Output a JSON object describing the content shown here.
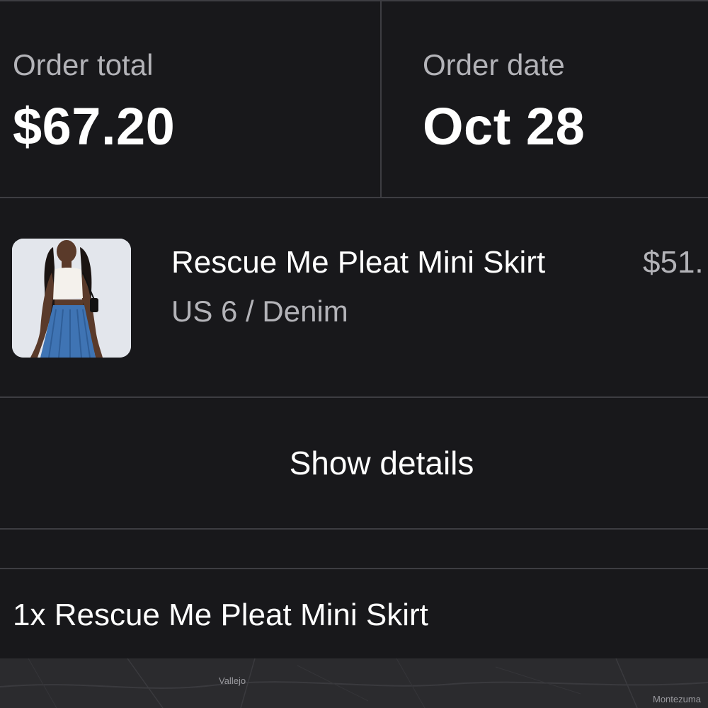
{
  "summary": {
    "total_label": "Order total",
    "total_value": "$67.20",
    "date_label": "Order date",
    "date_value": "Oct 28"
  },
  "item": {
    "name": "Rescue Me Pleat Mini Skirt",
    "variant": "US 6 / Denim",
    "price": "$51."
  },
  "actions": {
    "show_details_label": "Show details"
  },
  "line_items": [
    {
      "text": "1x Rescue Me Pleat Mini Skirt"
    }
  ],
  "map": {
    "labels": [
      "Vallejo",
      "Montezuma"
    ]
  },
  "colors": {
    "background": "#18181b",
    "divider": "#3d3d42",
    "secondary_text": "#b3b3b8",
    "primary_text": "#ffffff",
    "map_background": "#2b2b2e"
  }
}
